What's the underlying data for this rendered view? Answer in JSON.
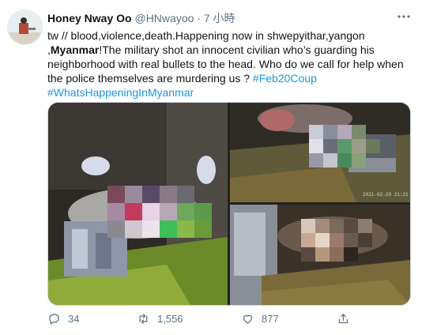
{
  "user": {
    "name": "Honey Nway Oo",
    "handle": "@HNwayoo",
    "separator": "·",
    "time": "7 小時"
  },
  "tweet": {
    "text_part1": "tw // blood,violence,death.Happening now in shwepyithar,yangon ,",
    "text_bold": "Myanmar",
    "text_part2": "!The military shot an innocent civilian who’s guarding his neighborhood with real bullets to the head. Who do we call for help when the police themselves are murdering us ? ",
    "hashtag1": "#Feb20Coup",
    "hashtag2": "#WhatsHappeningInMyanmar"
  },
  "media": {
    "photo3_timestamp": "2021-02-20 21:21"
  },
  "actions": {
    "replies": "34",
    "retweets": "1,556",
    "likes": "877"
  },
  "colors": {
    "link": "#1b95e0",
    "secondary_text": "#5b7083",
    "border": "#cfd9de"
  },
  "icons": [
    "more-icon",
    "reply-icon",
    "retweet-icon",
    "like-icon",
    "share-icon"
  ]
}
